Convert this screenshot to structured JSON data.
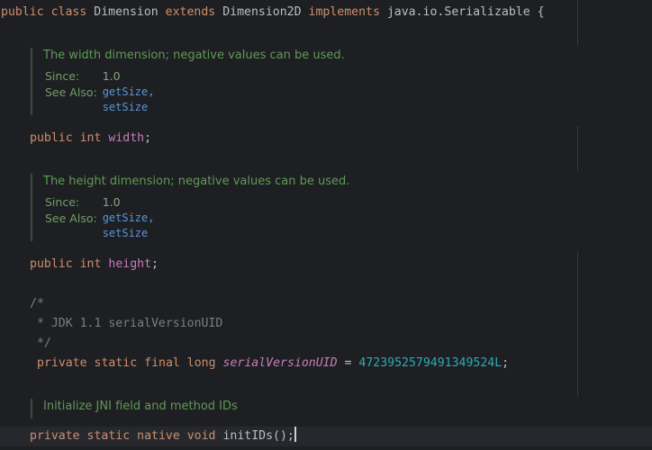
{
  "editor": {
    "class_decl": {
      "kw_public": "public",
      "kw_class": "class",
      "name": "Dimension",
      "kw_extends": "extends",
      "superclass": "Dimension2D",
      "kw_implements": "implements",
      "interface": "java.io.Serializable",
      "brace": "{"
    },
    "doc_width": {
      "description": "The width dimension; negative values can be used.",
      "since_label": "Since:",
      "since_value": "1.0",
      "see_also_label": "See Also:",
      "links": [
        "getSize,",
        "setSize"
      ]
    },
    "width_decl": {
      "kw_public": "public",
      "kw_type": "int",
      "name": "width",
      "semi": ";"
    },
    "doc_height": {
      "description": "The height dimension; negative values can be used.",
      "since_label": "Since:",
      "since_value": "1.0",
      "see_also_label": "See Also:",
      "links": [
        "getSize,",
        "setSize"
      ]
    },
    "height_decl": {
      "kw_public": "public",
      "kw_type": "int",
      "name": "height",
      "semi": ";"
    },
    "block_comment": {
      "open": "/*",
      "body": " * JDK 1.1 serialVersionUID",
      "close": " */"
    },
    "serial_decl": {
      "kw_private": "private",
      "kw_static": "static",
      "kw_final": "final",
      "kw_type": "long",
      "name": "serialVersionUID",
      "equals": " = ",
      "value": "4723952579491349524L",
      "semi": ";"
    },
    "doc_init": {
      "description": "Initialize JNI field and method IDs"
    },
    "init_decl": {
      "kw_private": "private",
      "kw_static": "static",
      "kw_native": "native",
      "kw_type": "void",
      "name": "initIDs",
      "parens": "()",
      "semi": ";"
    }
  },
  "colors": {
    "background": "#1e1f22",
    "keyword": "#cf8e6d",
    "field": "#c77dbb",
    "number": "#2aacb8",
    "doc_text": "#5f9a57",
    "doc_link": "#5896d8",
    "comment": "#7a7e85"
  }
}
